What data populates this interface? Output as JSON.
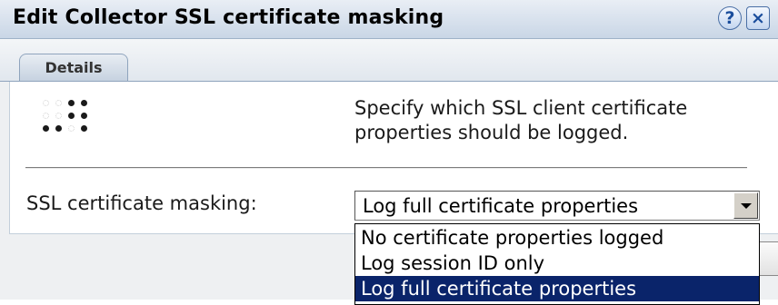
{
  "dialog": {
    "title": "Edit Collector SSL certificate masking",
    "help_icon": "?",
    "close_icon": "×"
  },
  "tabs": [
    {
      "label": "Details",
      "active": true
    }
  ],
  "content": {
    "description": "Specify which SSL client certificate properties should be logged.",
    "field_label": "SSL certificate masking:",
    "select": {
      "value": "Log full certificate properties",
      "options": [
        "No certificate properties logged",
        "Log session ID only",
        "Log full certificate properties"
      ],
      "selected_index": 2
    }
  },
  "colors": {
    "selected_option_bg": "#0a246a",
    "titlebar_gradient_top": "#e9eef5",
    "titlebar_gradient_bottom": "#c9d6e6"
  }
}
